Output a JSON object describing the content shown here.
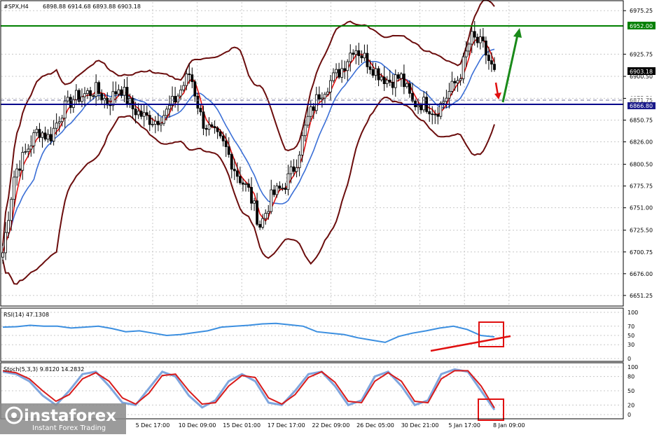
{
  "header": {
    "symbol": "#SPX,H4",
    "ohlc": "6898.88 6914.68 6893.88 6903.18"
  },
  "price_axis": {
    "ticks": [
      "6975.25",
      "6925.75",
      "6900.50",
      "6875.50",
      "6850.75",
      "6826.00",
      "6800.50",
      "6775.75",
      "6751.00",
      "6725.50",
      "6700.75",
      "6676.00",
      "6651.25"
    ],
    "last_price_label": "6903.18",
    "resistance_label": "6952.00",
    "level_label_1": "6871.75",
    "level_label_2": "6866.80"
  },
  "rsi_panel": {
    "title": "RSI(14) 47.1308",
    "ticks": [
      "100",
      "70",
      "50",
      "30",
      "0"
    ]
  },
  "stoch_panel": {
    "title": "Stoch(5,3,3) 9.8120 14.2832",
    "ticks": [
      "100",
      "80",
      "50",
      "20",
      "0"
    ]
  },
  "time_axis": {
    "labels": [
      "5 Dec 17:00",
      "10 Dec 09:00",
      "15 Dec 01:00",
      "17 Dec 17:00",
      "22 Dec 09:00",
      "26 Dec 05:00",
      "30 Dec 21:00",
      "5 Jan 17:00",
      "8 Jan 09:00"
    ]
  },
  "watermark": {
    "brand": "instaforex",
    "tagline": "Instant Forex Trading"
  },
  "colors": {
    "candles": "#000000",
    "bollinger": "#6b0d0d",
    "ma_fast": "#e01010",
    "ma_slow": "#3b6fd6",
    "support_line": "#00008b",
    "resistance_line": "#008000",
    "rsi_line": "#3c8fe0",
    "stoch_main": "#7fa6de",
    "stoch_signal": "#d81b1b",
    "annotation_red": "#e01010",
    "annotation_green": "#1a8a1a"
  },
  "chart_data": [
    {
      "type": "candlestick",
      "title": "#SPX,H4",
      "ylim": [
        6640,
        6985
      ],
      "last_price": 6903.18,
      "horizontal_levels": [
        {
          "value": 6952.0,
          "color": "green"
        },
        {
          "value": 6866.8,
          "color": "navy"
        },
        {
          "value": 6871.75,
          "color": "dashed"
        }
      ],
      "x_labels": [
        "5 Dec 17:00",
        "10 Dec 09:00",
        "15 Dec 01:00",
        "17 Dec 17:00",
        "22 Dec 09:00",
        "26 Dec 05:00",
        "30 Dec 21:00",
        "5 Jan 17:00",
        "8 Jan 09:00"
      ],
      "close_path": [
        6700,
        6790,
        6815,
        6840,
        6830,
        6860,
        6875,
        6880,
        6885,
        6870,
        6890,
        6865,
        6855,
        6850,
        6860,
        6880,
        6905,
        6850,
        6835,
        6820,
        6790,
        6770,
        6730,
        6765,
        6775,
        6800,
        6850,
        6880,
        6895,
        6910,
        6935,
        6920,
        6905,
        6895,
        6900,
        6870,
        6870,
        6860,
        6880,
        6900,
        6945,
        6935,
        6903
      ]
    },
    {
      "type": "line",
      "title": "RSI(14) 47.1308",
      "ylim": [
        0,
        100
      ],
      "series": [
        {
          "name": "RSI(14)",
          "values": [
            68,
            69,
            72,
            70,
            70,
            66,
            68,
            70,
            65,
            58,
            60,
            55,
            50,
            52,
            56,
            60,
            68,
            70,
            72,
            75,
            76,
            73,
            70,
            58,
            55,
            52,
            45,
            40,
            35,
            48,
            55,
            60,
            66,
            70,
            63,
            50,
            47
          ]
        }
      ]
    },
    {
      "type": "line",
      "title": "Stoch(5,3,3) 9.8120 14.2832",
      "ylim": [
        0,
        100
      ],
      "series": [
        {
          "name": "Stoch main",
          "values": [
            90,
            85,
            70,
            40,
            20,
            50,
            85,
            90,
            60,
            25,
            20,
            55,
            90,
            80,
            40,
            15,
            30,
            70,
            85,
            70,
            25,
            20,
            50,
            85,
            90,
            60,
            20,
            30,
            80,
            90,
            60,
            20,
            30,
            85,
            95,
            90,
            50,
            10
          ]
        },
        {
          "name": "Stoch signal",
          "values": [
            92,
            88,
            75,
            50,
            28,
            42,
            75,
            88,
            70,
            35,
            22,
            45,
            82,
            85,
            50,
            22,
            25,
            60,
            82,
            78,
            35,
            22,
            42,
            78,
            90,
            68,
            28,
            25,
            70,
            88,
            70,
            28,
            25,
            75,
            92,
            92,
            60,
            14
          ]
        }
      ]
    }
  ]
}
